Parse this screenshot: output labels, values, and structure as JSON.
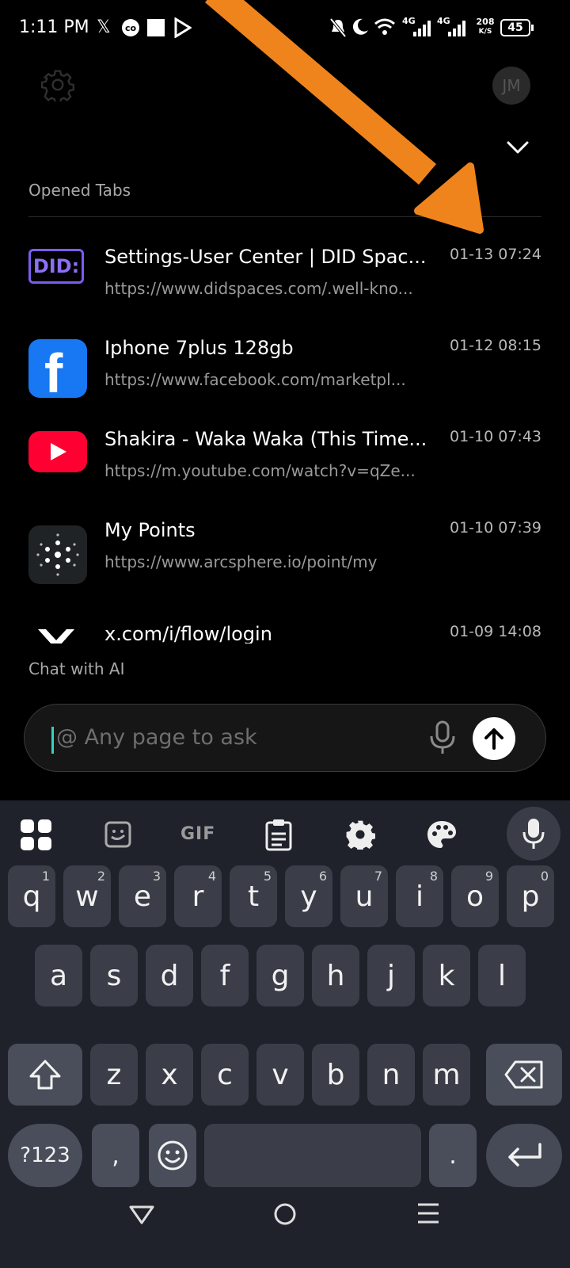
{
  "status_bar": {
    "time": "1:11 PM",
    "net_speed_top": "208",
    "net_speed_unit": "K/S",
    "battery": "45",
    "signal_1": "4G",
    "signal_2": "4G"
  },
  "header": {
    "avatar_initials": "JM"
  },
  "opened_tabs": {
    "label": "Opened Tabs",
    "items": [
      {
        "title": "Settings-User Center | DID Spac...",
        "url": "https://www.didspaces.com/.well-kno...",
        "time": "01-13 07:24",
        "icon": "did-spaces-icon"
      },
      {
        "title": "Iphone 7plus 128gb",
        "url": "https://www.facebook.com/marketpl...",
        "time": "01-12 08:15",
        "icon": "facebook-icon"
      },
      {
        "title": "Shakira - Waka Waka (This Time...",
        "url": "https://m.youtube.com/watch?v=qZe...",
        "time": "01-10 07:43",
        "icon": "youtube-icon"
      },
      {
        "title": "My Points",
        "url": "https://www.arcsphere.io/point/my",
        "time": "01-10 07:39",
        "icon": "arcsphere-icon"
      },
      {
        "title": "x.com/i/flow/login",
        "url": "",
        "time": "01-09 14:08",
        "icon": "x-icon"
      }
    ]
  },
  "chat": {
    "label": "Chat with AI",
    "placeholder": "@ Any page to ask"
  },
  "keyboard": {
    "toolbar": {
      "gif_label": "GIF"
    },
    "row1": [
      {
        "k": "q",
        "n": "1"
      },
      {
        "k": "w",
        "n": "2"
      },
      {
        "k": "e",
        "n": "3"
      },
      {
        "k": "r",
        "n": "4"
      },
      {
        "k": "t",
        "n": "5"
      },
      {
        "k": "y",
        "n": "6"
      },
      {
        "k": "u",
        "n": "7"
      },
      {
        "k": "i",
        "n": "8"
      },
      {
        "k": "o",
        "n": "9"
      },
      {
        "k": "p",
        "n": "0"
      }
    ],
    "row2": [
      "a",
      "s",
      "d",
      "f",
      "g",
      "h",
      "j",
      "k",
      "l"
    ],
    "row3": [
      "z",
      "x",
      "c",
      "v",
      "b",
      "n",
      "m"
    ],
    "symbols_label": "?123",
    "comma": ",",
    "period": "."
  },
  "colors": {
    "accent_arrow": "#f0841c",
    "keyboard_bg": "#1f222b",
    "key_bg": "#3b3e49",
    "caret": "#35d0c0"
  }
}
